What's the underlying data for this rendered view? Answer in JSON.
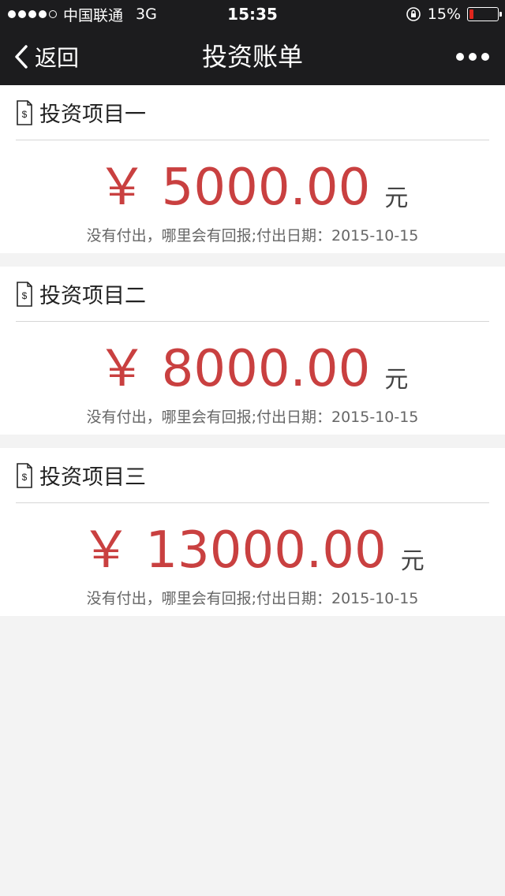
{
  "status_bar": {
    "carrier": "中国联通",
    "network": "3G",
    "time": "15:35",
    "battery_text": "15%",
    "battery_level": 0.15,
    "battery_color": "#e0261d",
    "signal_icon": "signal-dots-icon",
    "orientation_lock_icon": "orientation-lock-icon"
  },
  "nav": {
    "back_label": "返回",
    "title": "投资账单",
    "more_icon": "more-dots-icon"
  },
  "accent_color": "#c94040",
  "investments": [
    {
      "title": "投资项目一",
      "currency": "￥",
      "amount": "5000.00",
      "unit": "元",
      "note": "没有付出，哪里会有回报;付出日期：2015-10-15"
    },
    {
      "title": "投资项目二",
      "currency": "￥",
      "amount": "8000.00",
      "unit": "元",
      "note": "没有付出，哪里会有回报;付出日期：2015-10-15"
    },
    {
      "title": "投资项目三",
      "currency": "￥",
      "amount": "13000.00",
      "unit": "元",
      "note": "没有付出，哪里会有回报;付出日期：2015-10-15"
    }
  ]
}
